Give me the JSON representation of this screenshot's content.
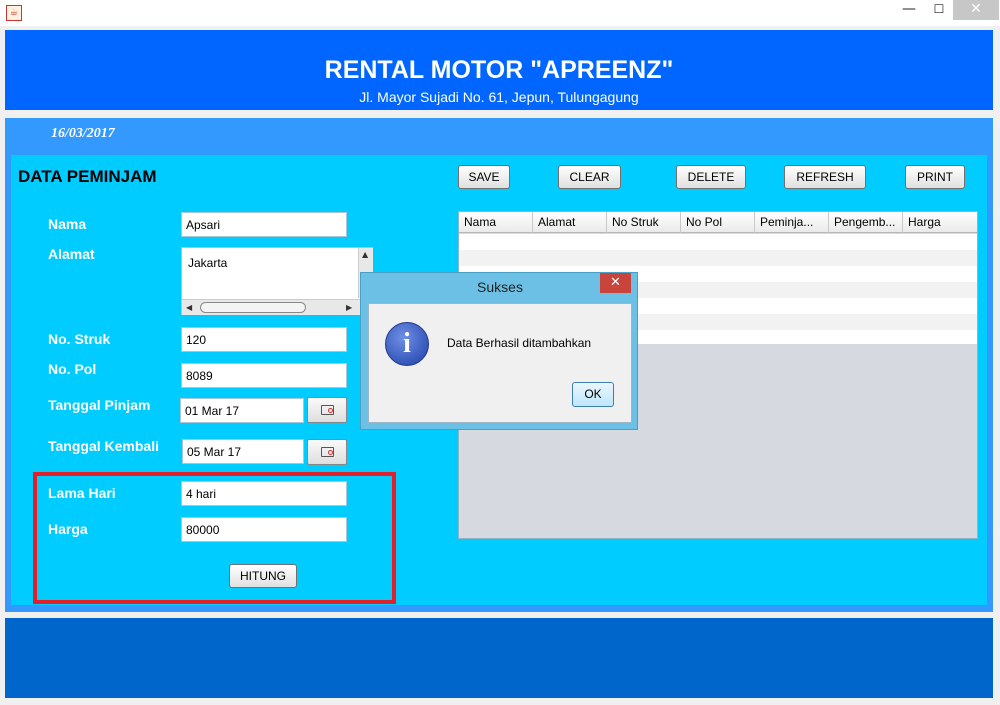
{
  "window": {
    "app_icon": "java-cup-icon",
    "minimize": "—",
    "maximize": "☐",
    "close": "✕"
  },
  "header": {
    "title": "RENTAL MOTOR \"APREENZ\"",
    "subtitle": "Jl. Mayor Sujadi No. 61, Jepun, Tulungagung"
  },
  "date": "16/03/2017",
  "section_title": "DATA PEMINJAM",
  "toolbar": {
    "save": "SAVE",
    "clear": "CLEAR",
    "delete": "DELETE",
    "refresh": "REFRESH",
    "print": "PRINT"
  },
  "form": {
    "nama_label": "Nama",
    "nama_value": "Apsari",
    "alamat_label": "Alamat",
    "alamat_value": "Jakarta",
    "struk_label": "No. Struk",
    "struk_value": "120",
    "pol_label": "No. Pol",
    "pol_value": "8089",
    "pinjam_label": "Tanggal Pinjam",
    "pinjam_value": "01 Mar 17",
    "kembali_label": "Tanggal Kembali",
    "kembali_value": "05 Mar 17",
    "lama_label": "Lama Hari",
    "lama_value": "4 hari",
    "harga_label": "Harga",
    "harga_value": "80000",
    "hitung": "HITUNG"
  },
  "table": {
    "columns": [
      "Nama",
      "Alamat",
      "No Struk",
      "No Pol",
      "Peminja...",
      "Pengemb...",
      "Harga"
    ]
  },
  "dialog": {
    "title": "Sukses",
    "message": "Data Berhasil ditambahkan",
    "ok": "OK",
    "close": "✕",
    "icon": "info-icon"
  },
  "colors": {
    "header": "#0066ff",
    "strip": "#3399ff",
    "panel": "#00ccff",
    "footer": "#0066cc",
    "highlight": "#e0202a"
  }
}
